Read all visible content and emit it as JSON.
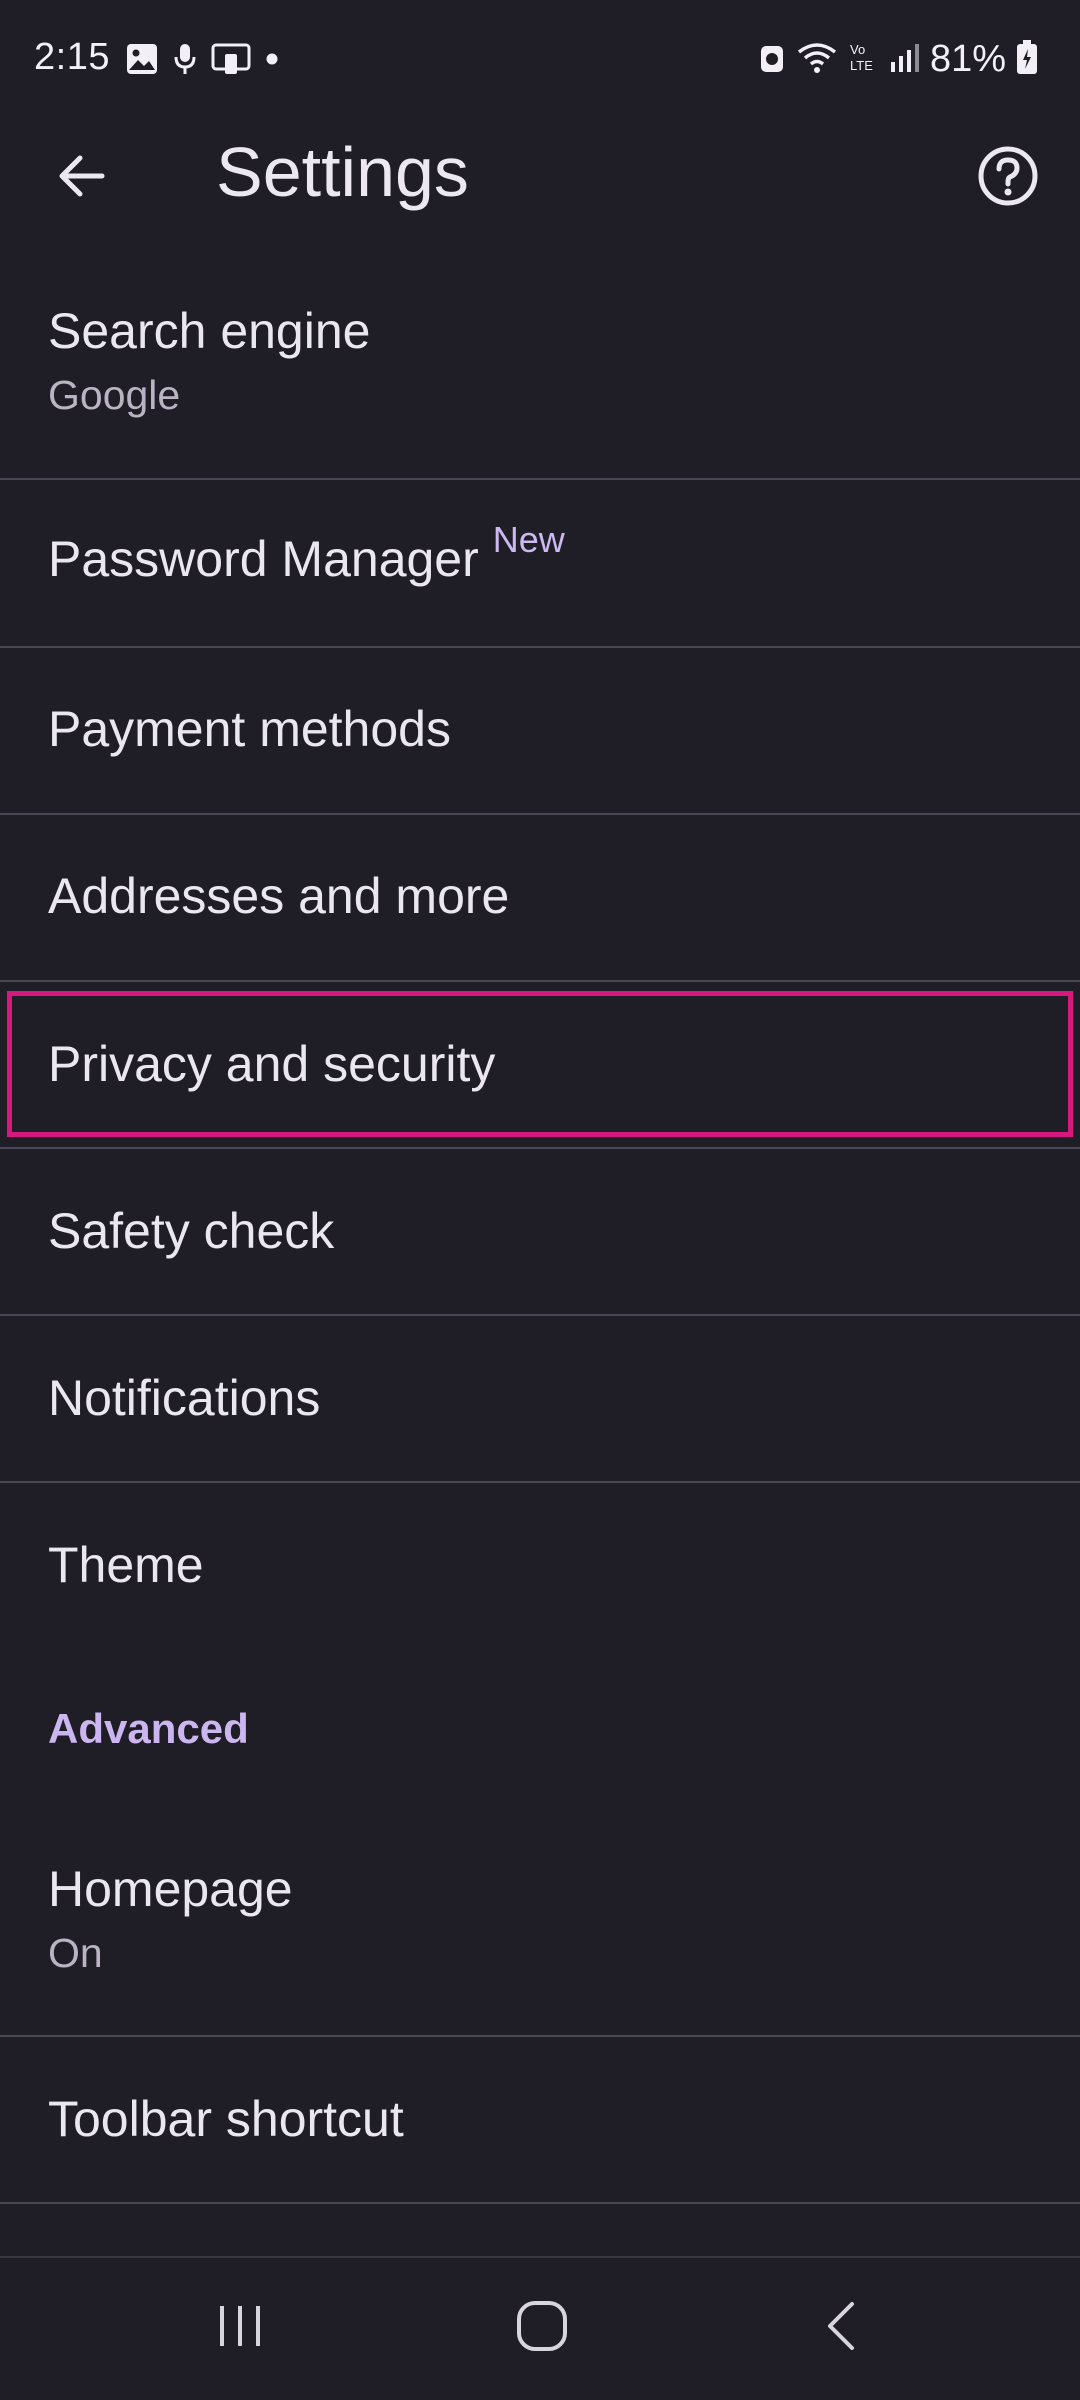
{
  "status_bar": {
    "time": "2:15",
    "battery_percent": "81%",
    "left_icons": [
      "image-icon",
      "mic-icon",
      "cast-icon",
      "dot-icon"
    ],
    "right_icons": [
      "alarm-icon",
      "wifi-icon",
      "volte-icon",
      "signal-icon",
      "battery-icon"
    ]
  },
  "app_bar": {
    "title": "Settings",
    "back_icon": "arrow-back-icon",
    "help_icon": "help-icon"
  },
  "items": [
    {
      "title": "Search engine",
      "subtitle": "Google"
    },
    {
      "title": "Password Manager",
      "badge": "New"
    },
    {
      "title": "Payment methods"
    },
    {
      "title": "Addresses and more"
    },
    {
      "title": "Privacy and security",
      "highlighted": true
    },
    {
      "title": "Safety check"
    },
    {
      "title": "Notifications"
    },
    {
      "title": "Theme"
    }
  ],
  "advanced_section": {
    "header": "Advanced",
    "items": [
      {
        "title": "Homepage",
        "subtitle": "On"
      },
      {
        "title": "Toolbar shortcut"
      }
    ]
  },
  "colors": {
    "background": "#1f1d26",
    "accent": "#cbb6ef",
    "highlight": "#d6197e",
    "divider": "#4a4655"
  }
}
